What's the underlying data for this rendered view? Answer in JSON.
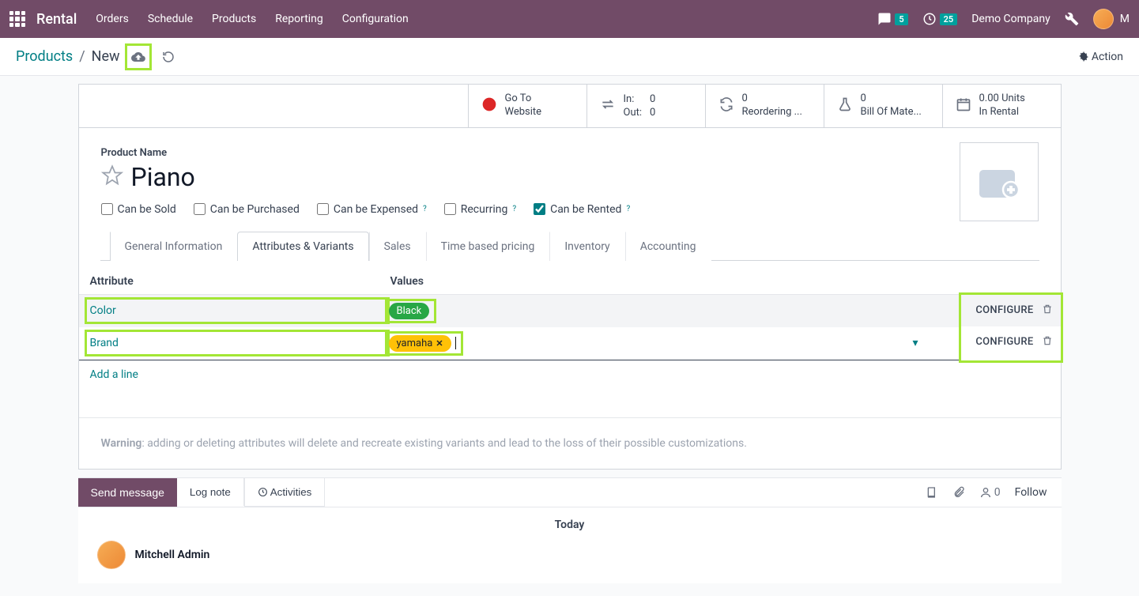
{
  "topbar": {
    "brand": "Rental",
    "nav": [
      "Orders",
      "Schedule",
      "Products",
      "Reporting",
      "Configuration"
    ],
    "chat_count": "5",
    "activity_count": "25",
    "company": "Demo Company",
    "user_initial": "M"
  },
  "breadcrumb": {
    "root": "Products",
    "current": "New",
    "action": "Action"
  },
  "stats": {
    "go_to_website_l1": "Go To",
    "go_to_website_l2": "Website",
    "in_label": "In:",
    "in_val": "0",
    "out_label": "Out:",
    "out_val": "0",
    "reorder_num": "0",
    "reorder_label": "Reordering ...",
    "bom_num": "0",
    "bom_label": "Bill Of Mate...",
    "rental_num": "0.00 Units",
    "rental_label": "In Rental"
  },
  "form": {
    "name_label": "Product Name",
    "name_value": "Piano",
    "checks": {
      "sold": "Can be Sold",
      "purchased": "Can be Purchased",
      "expensed": "Can be Expensed",
      "recurring": "Recurring",
      "rented": "Can be Rented"
    }
  },
  "tabs": [
    "General Information",
    "Attributes & Variants",
    "Sales",
    "Time based pricing",
    "Inventory",
    "Accounting"
  ],
  "active_tab": "Attributes & Variants",
  "attr_headers": {
    "attribute": "Attribute",
    "values": "Values"
  },
  "rows": [
    {
      "attribute": "Color",
      "tag": "Black",
      "tag_color": "green",
      "removable": false
    },
    {
      "attribute": "Brand",
      "tag": "yamaha",
      "tag_color": "yellow",
      "removable": true
    }
  ],
  "configure_label": "CONFIGURE",
  "add_line": "Add a line",
  "warning_label": "Warning",
  "warning_text": ": adding or deleting attributes will delete and recreate existing variants and lead to the loss of their possible customizations.",
  "chatter": {
    "send_message": "Send message",
    "log_note": "Log note",
    "activities": "Activities",
    "follower_count": "0",
    "follow": "Follow",
    "today": "Today",
    "user": "Mitchell Admin"
  }
}
